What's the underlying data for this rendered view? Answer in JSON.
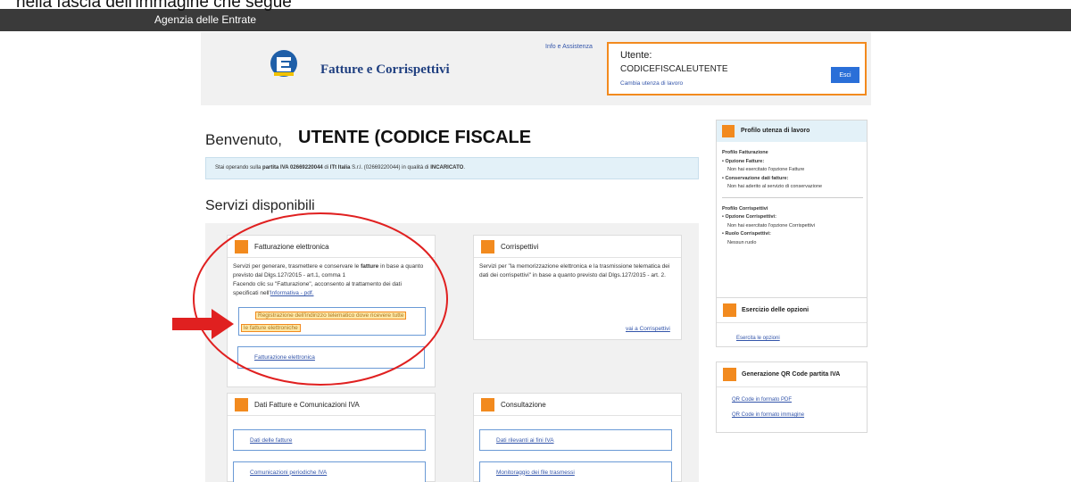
{
  "overlay": {
    "text": "nella fascia dell'immagine che segue"
  },
  "topbar": {
    "title": "Agenzia delle Entrate"
  },
  "header": {
    "brand": "Fatture e Corrispettivi",
    "info_link": "Info e Assistenza",
    "user_label": "Utente:",
    "user_code": "CODICEFISCALEUTENTE",
    "change_link": "Cambia utenza di lavoro",
    "exit_label": "Esci"
  },
  "welcome": {
    "greeting": "Benvenuto,",
    "name": "UTENTE (CODICE FISCALE"
  },
  "notice": {
    "prefix": "Stai operando sulla ",
    "vat": "partita IVA 02669220044",
    "mid": " di ",
    "company": "ITt Italia",
    "suffix": " S.r.l. (02669220044) in qualità di ",
    "role": "INCARICATO",
    "end": "."
  },
  "services": {
    "title": "Servizi disponibili",
    "fatturazione": {
      "title": "Fatturazione elettronica",
      "desc_a": "Servizi per generare, trasmettere e conservare le ",
      "desc_bold": "fatture",
      "desc_b": " in base a quanto previsto dal Dlgs.127/2015 - art.1, comma 1",
      "desc_c": "Facendo clic su \"Fatturazione\", acconsento al trattamento dei dati specificati nell'",
      "informativa": "Informativa - pdf.",
      "highlight_line1": "Registrazione dell'indirizzo telematico dove ricevere tutte",
      "highlight_line2": "le fatture elettroniche",
      "link2": "Fatturazione elettronica"
    },
    "corrispettivi": {
      "title": "Corrispettivi",
      "desc": "Servizi per \"la memorizzazione elettronica e la trasmissione telematica dei dati dei corrispettivi\" in base a quanto previsto dal Dlgs.127/2015 - art. 2.",
      "link": "vai a Corrispettivi"
    },
    "dati_fatture": {
      "title": "Dati Fatture e Comunicazioni IVA",
      "link1": "Dati delle fatture",
      "link2": "Comunicazioni periodiche IVA"
    },
    "consultazione": {
      "title": "Consultazione",
      "link1": "Dati rilevanti ai fini IVA",
      "link2": "Monitoraggio dei file trasmessi"
    }
  },
  "sidebar": {
    "profilo": {
      "title": "Profilo utenza di lavoro",
      "fatt_heading": "Profilo Fatturazione",
      "opt_fatture_label": "• Opzione Fatture:",
      "opt_fatture_value": "Non hai esercitato l'opzione Fatture",
      "cons_label": "• Conservazione dati fatture:",
      "cons_value": "Non hai aderito al servizio di conservazione",
      "corr_heading": "Profilo Corrispettivi",
      "opt_corr_label": "• Opzione Corrispettivi:",
      "opt_corr_value": "Non hai esercitato l'opzione Corrispettivi",
      "ruolo_label": "• Ruolo Corrispettivi:",
      "ruolo_value": "Nessun ruolo"
    },
    "esercizio": {
      "title": "Esercizio delle opzioni",
      "link": "Esercita le opzioni"
    },
    "qr": {
      "title": "Generazione QR Code partita IVA",
      "link1": "QR Code in formato PDF",
      "link2": "QR Code in formato immagine"
    }
  },
  "colors": {
    "accent": "#f28a1e",
    "link": "#3355aa",
    "topbar": "#3a3a3a",
    "notice_bg": "#e3f1f8",
    "annotation": "#e02020"
  }
}
